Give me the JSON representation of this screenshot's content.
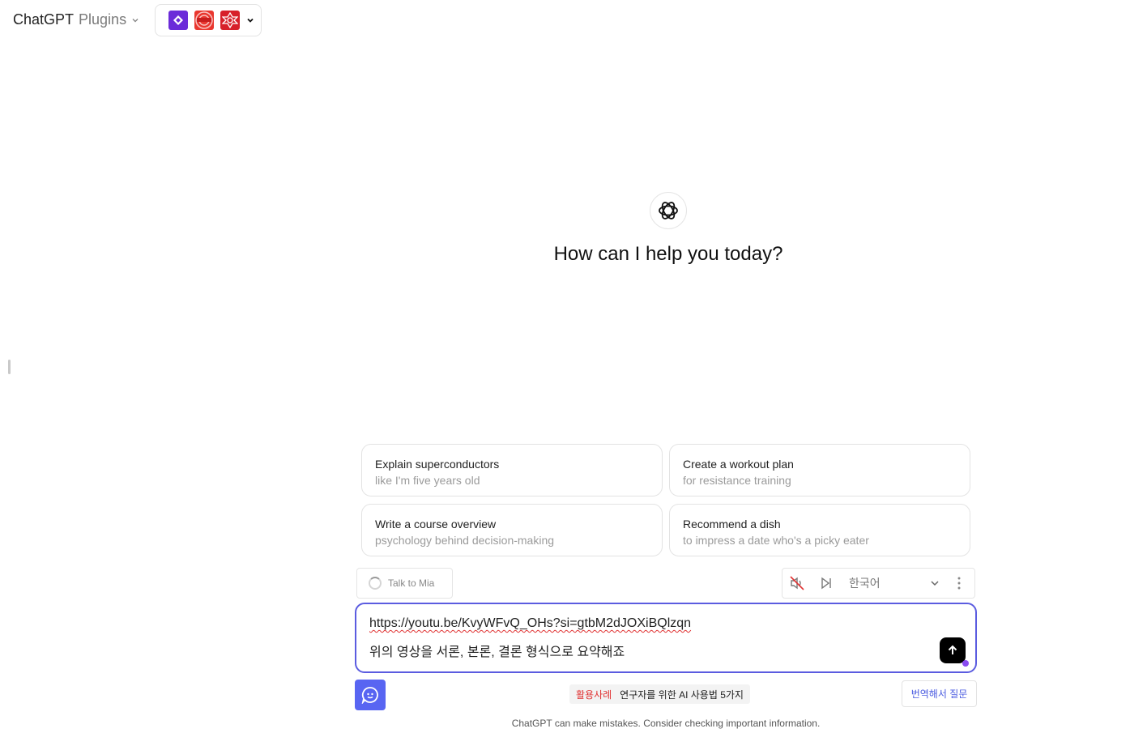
{
  "header": {
    "model_name": "ChatGPT",
    "model_variant": "Plugins",
    "plugin_icons": [
      "app-plugin-icon",
      "webpilot-icon",
      "wolfram-icon"
    ]
  },
  "hero": {
    "title": "How can I help you today?"
  },
  "suggestions": [
    {
      "title": "Explain superconductors",
      "subtitle": "like I'm five years old"
    },
    {
      "title": "Create a workout plan",
      "subtitle": "for resistance training"
    },
    {
      "title": "Write a course overview",
      "subtitle": "psychology behind decision-making"
    },
    {
      "title": "Recommend a dish",
      "subtitle": "to impress a date who's a picky eater"
    }
  ],
  "voice": {
    "talk_label": "Talk to Mia",
    "language": "한국어"
  },
  "composer": {
    "line1": "https://youtu.be/KvyWFvQ_OHs?si=gtbM2dJOXiBQlzqn",
    "line2": "위의 영상을 서론, 본론, 결론 형식으로 요약해죠"
  },
  "footer": {
    "promo_tag": "활용사례",
    "promo_text": "연구자를 위한 AI 사용법 5가지",
    "translate_label": "번역해서 질문",
    "disclaimer": "ChatGPT can make mistakes. Consider checking important information."
  },
  "colors": {
    "accent": "#5b5ce0",
    "assistant_button": "#5865f2",
    "promo_tag": "#e03131",
    "send_button": "#000000"
  }
}
